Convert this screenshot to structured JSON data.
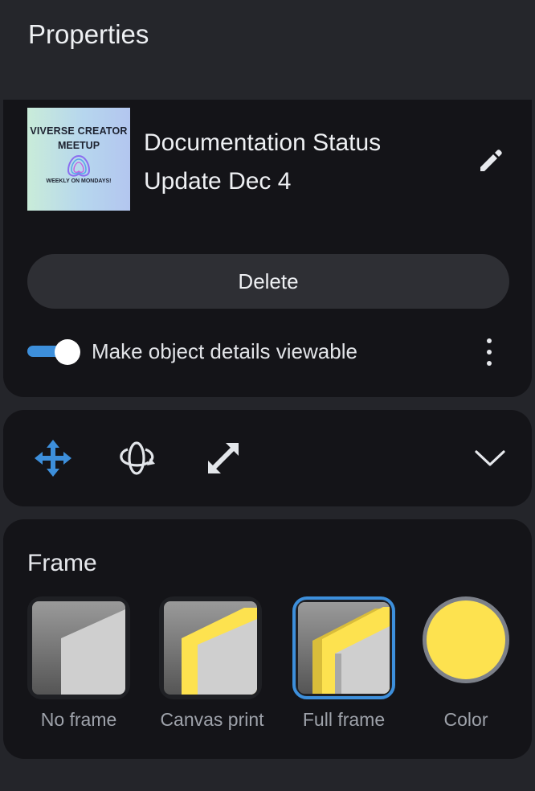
{
  "header": {
    "title": "Properties"
  },
  "object": {
    "thumbnail": {
      "line1": "VIVERSE CREATOR",
      "line2": "MEETUP",
      "line3": "WEEKLY ON MONDAYS!"
    },
    "title": "Documentation Status Update Dec 4",
    "delete_label": "Delete",
    "toggle_label": "Make object details viewable",
    "toggle_on": true
  },
  "tools": {
    "items": [
      "move-icon",
      "rotate-icon",
      "scale-icon"
    ],
    "expand_icon": "chevron-down-icon"
  },
  "frame": {
    "title": "Frame",
    "options": [
      {
        "label": "No frame",
        "selected": false
      },
      {
        "label": "Canvas print",
        "selected": false
      },
      {
        "label": "Full frame",
        "selected": true
      },
      {
        "label": "Color",
        "selected": false
      }
    ],
    "color": "#fde24f"
  },
  "colors": {
    "accent": "#3d8fdb",
    "background": "#24252a",
    "card": "#141418"
  }
}
